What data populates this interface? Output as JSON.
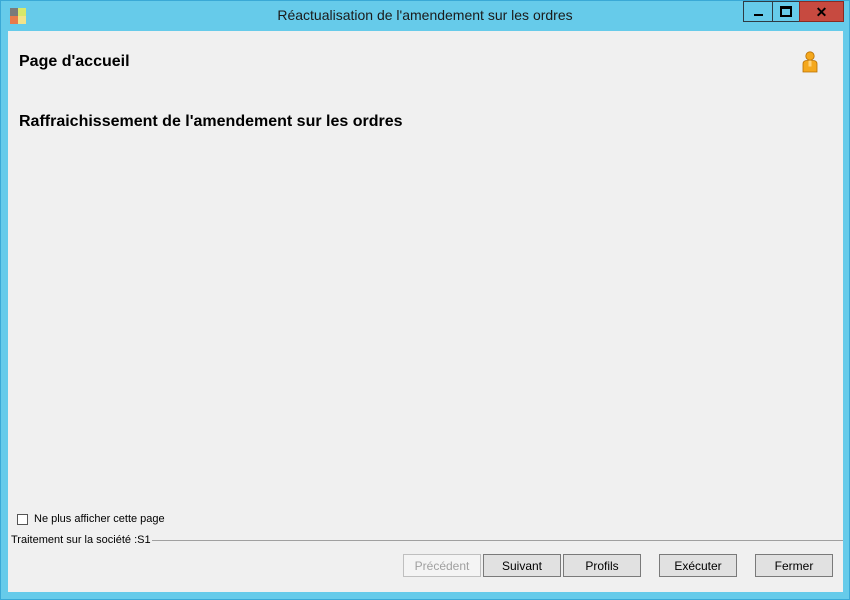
{
  "window": {
    "title": "Réactualisation de l'amendement sur les ordres",
    "controls": {
      "minimize_icon": "minimize-icon",
      "maximize_icon": "maximize-icon",
      "close_icon": "close-icon",
      "close_glyph": "✕"
    },
    "colors": {
      "titlebar": "#66cbea",
      "close_button": "#c74a40",
      "client_bg": "#f0f0f0"
    }
  },
  "header": {
    "page_title": "Page d'accueil",
    "user_icon": "user-icon"
  },
  "main": {
    "section_title": "Raffraichissement de l'amendement sur les ordres"
  },
  "footer": {
    "dont_show_label": "Ne plus afficher cette page",
    "dont_show_checked": false,
    "status_text": "Traitement sur la société :S1",
    "buttons": {
      "previous": "Précédent",
      "next": "Suivant",
      "profiles": "Profils",
      "execute": "Exécuter",
      "close": "Fermer"
    },
    "previous_disabled": true
  }
}
